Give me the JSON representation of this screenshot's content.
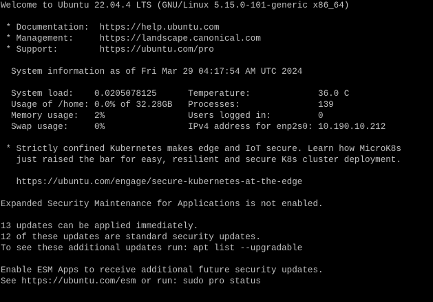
{
  "terminal": {
    "colors": {
      "background": "#000000",
      "foreground": "#c0c0c0"
    },
    "lines": [
      "Welcome to Ubuntu 22.04.4 LTS (GNU/Linux 5.15.0-101-generic x86_64)",
      "",
      " * Documentation:  https://help.ubuntu.com",
      " * Management:     https://landscape.canonical.com",
      " * Support:        https://ubuntu.com/pro",
      "",
      "  System information as of Fri Mar 29 04:17:54 AM UTC 2024",
      "",
      "  System load:    0.0205078125      Temperature:             36.0 C",
      "  Usage of /home: 0.0% of 32.28GB   Processes:               139",
      "  Memory usage:   2%                Users logged in:         0",
      "  Swap usage:     0%                IPv4 address for enp2s0: 10.190.10.212",
      "",
      " * Strictly confined Kubernetes makes edge and IoT secure. Learn how MicroK8s",
      "   just raised the bar for easy, resilient and secure K8s cluster deployment.",
      "",
      "   https://ubuntu.com/engage/secure-kubernetes-at-the-edge",
      "",
      "Expanded Security Maintenance for Applications is not enabled.",
      "",
      "13 updates can be applied immediately.",
      "12 of these updates are standard security updates.",
      "To see these additional updates run: apt list --upgradable",
      "",
      "Enable ESM Apps to receive additional future security updates.",
      "See https://ubuntu.com/esm or run: sudo pro status",
      ""
    ]
  }
}
